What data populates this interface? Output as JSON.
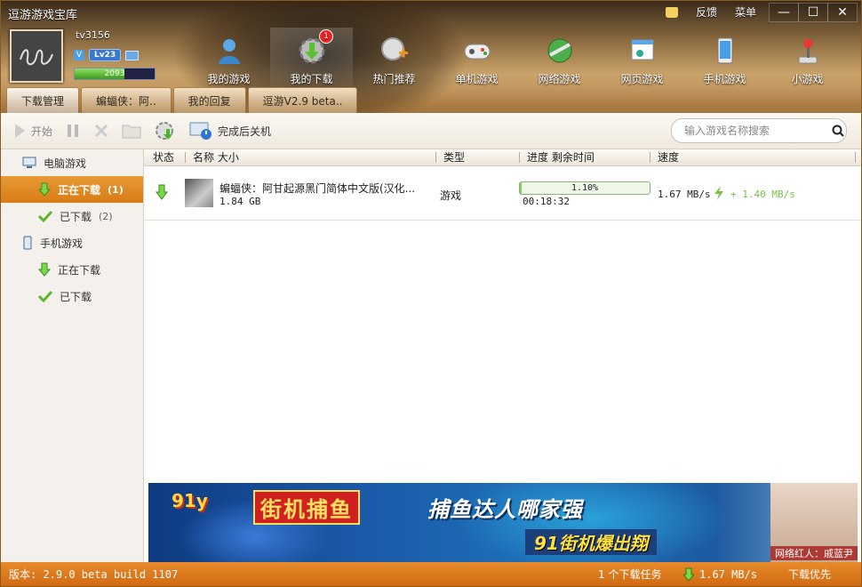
{
  "app": {
    "title": "逗游游戏宝库"
  },
  "top_links": {
    "feedback": "反馈",
    "menu": "菜单"
  },
  "window_controls": {
    "minimize": "—",
    "maximize": "☐",
    "close": "✕"
  },
  "user": {
    "name": "tv3156",
    "level": "Lv23",
    "exp_text": "2093",
    "exp_fraction": 0.62
  },
  "nav": [
    {
      "label": "我的游戏",
      "icon": "user-games-icon"
    },
    {
      "label": "我的下载",
      "icon": "download-gear-icon",
      "badge": "1"
    },
    {
      "label": "热门推荐",
      "icon": "hot-recommend-icon"
    },
    {
      "label": "单机游戏",
      "icon": "gamepad-icon"
    },
    {
      "label": "网络游戏",
      "icon": "globe-icon"
    },
    {
      "label": "网页游戏",
      "icon": "web-game-icon"
    },
    {
      "label": "手机游戏",
      "icon": "phone-icon"
    },
    {
      "label": "小游戏",
      "icon": "joystick-icon"
    }
  ],
  "tabs": [
    "下载管理",
    "蝙蝠侠：阿..",
    "我的回复",
    "逗游V2.9 beta.."
  ],
  "toolbar": {
    "start": "开始",
    "shutdown": "完成后关机",
    "search_placeholder": "输入游戏名称搜索"
  },
  "sidebar": {
    "pc_category": "电脑游戏",
    "pc_downloading": "正在下载",
    "pc_downloading_count": "(1)",
    "pc_downloaded": "已下载",
    "pc_downloaded_count": "(2)",
    "mobile_category": "手机游戏",
    "mobile_downloading": "正在下载",
    "mobile_downloaded": "已下载"
  },
  "list": {
    "headers": {
      "status": "状态",
      "name": "名称 大小",
      "type": "类型",
      "progress": "进度 剩余时间",
      "speed": "速度"
    },
    "rows": [
      {
        "name": "蝙蝠侠：阿甘起源黑门简体中文版(汉化...",
        "size": "1.84 GB",
        "type": "游戏",
        "progress_text": "1.10%",
        "progress_fraction": 0.011,
        "remaining": "00:18:32",
        "speed": "1.67 MB/s",
        "boost": "+ 1.40 MB/s"
      }
    ]
  },
  "ad": {
    "logo": "91y",
    "brand": "街机捕鱼",
    "slogan1": "捕鱼达人哪家强",
    "slogan2": "91街机爆出翔",
    "caption": "网络红人：戚蓝尹"
  },
  "status": {
    "version": "版本: 2.9.0 beta build 1107",
    "tasks": "1 个下载任务",
    "speed": "1.67 MB/s",
    "priority": "下载优先"
  },
  "colors": {
    "accent": "#e07d1a",
    "progress": "#8ccc5c",
    "boost": "#78c04a"
  }
}
